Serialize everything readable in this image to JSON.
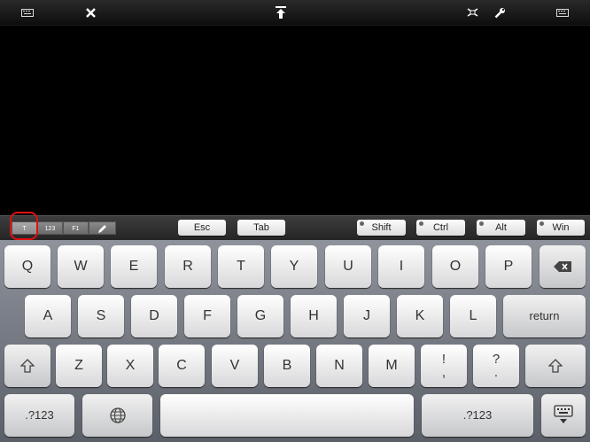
{
  "toolbar": {
    "icons": [
      "keyboard-icon",
      "close-icon",
      "upload-icon",
      "fullscreen-icon",
      "wrench-icon",
      "keyboard-icon"
    ]
  },
  "funcbar": {
    "segments": [
      "T",
      "123",
      "F1"
    ],
    "esc": "Esc",
    "tab": "Tab",
    "shift": "Shift",
    "ctrl": "Ctrl",
    "alt": "Alt",
    "win": "Win"
  },
  "keyboard": {
    "row1": [
      "Q",
      "W",
      "E",
      "R",
      "T",
      "Y",
      "U",
      "I",
      "O",
      "P"
    ],
    "row2": [
      "A",
      "S",
      "D",
      "F",
      "G",
      "H",
      "J",
      "K",
      "L"
    ],
    "return": "return",
    "row3": [
      "Z",
      "X",
      "C",
      "V",
      "B",
      "N",
      "M"
    ],
    "punct1": {
      "top": "!",
      "bottom": ","
    },
    "punct2": {
      "top": "?",
      "bottom": "."
    },
    "numbers_left": ".?123",
    "numbers_right": ".?123"
  },
  "colors": {
    "highlight": "#e01010"
  }
}
